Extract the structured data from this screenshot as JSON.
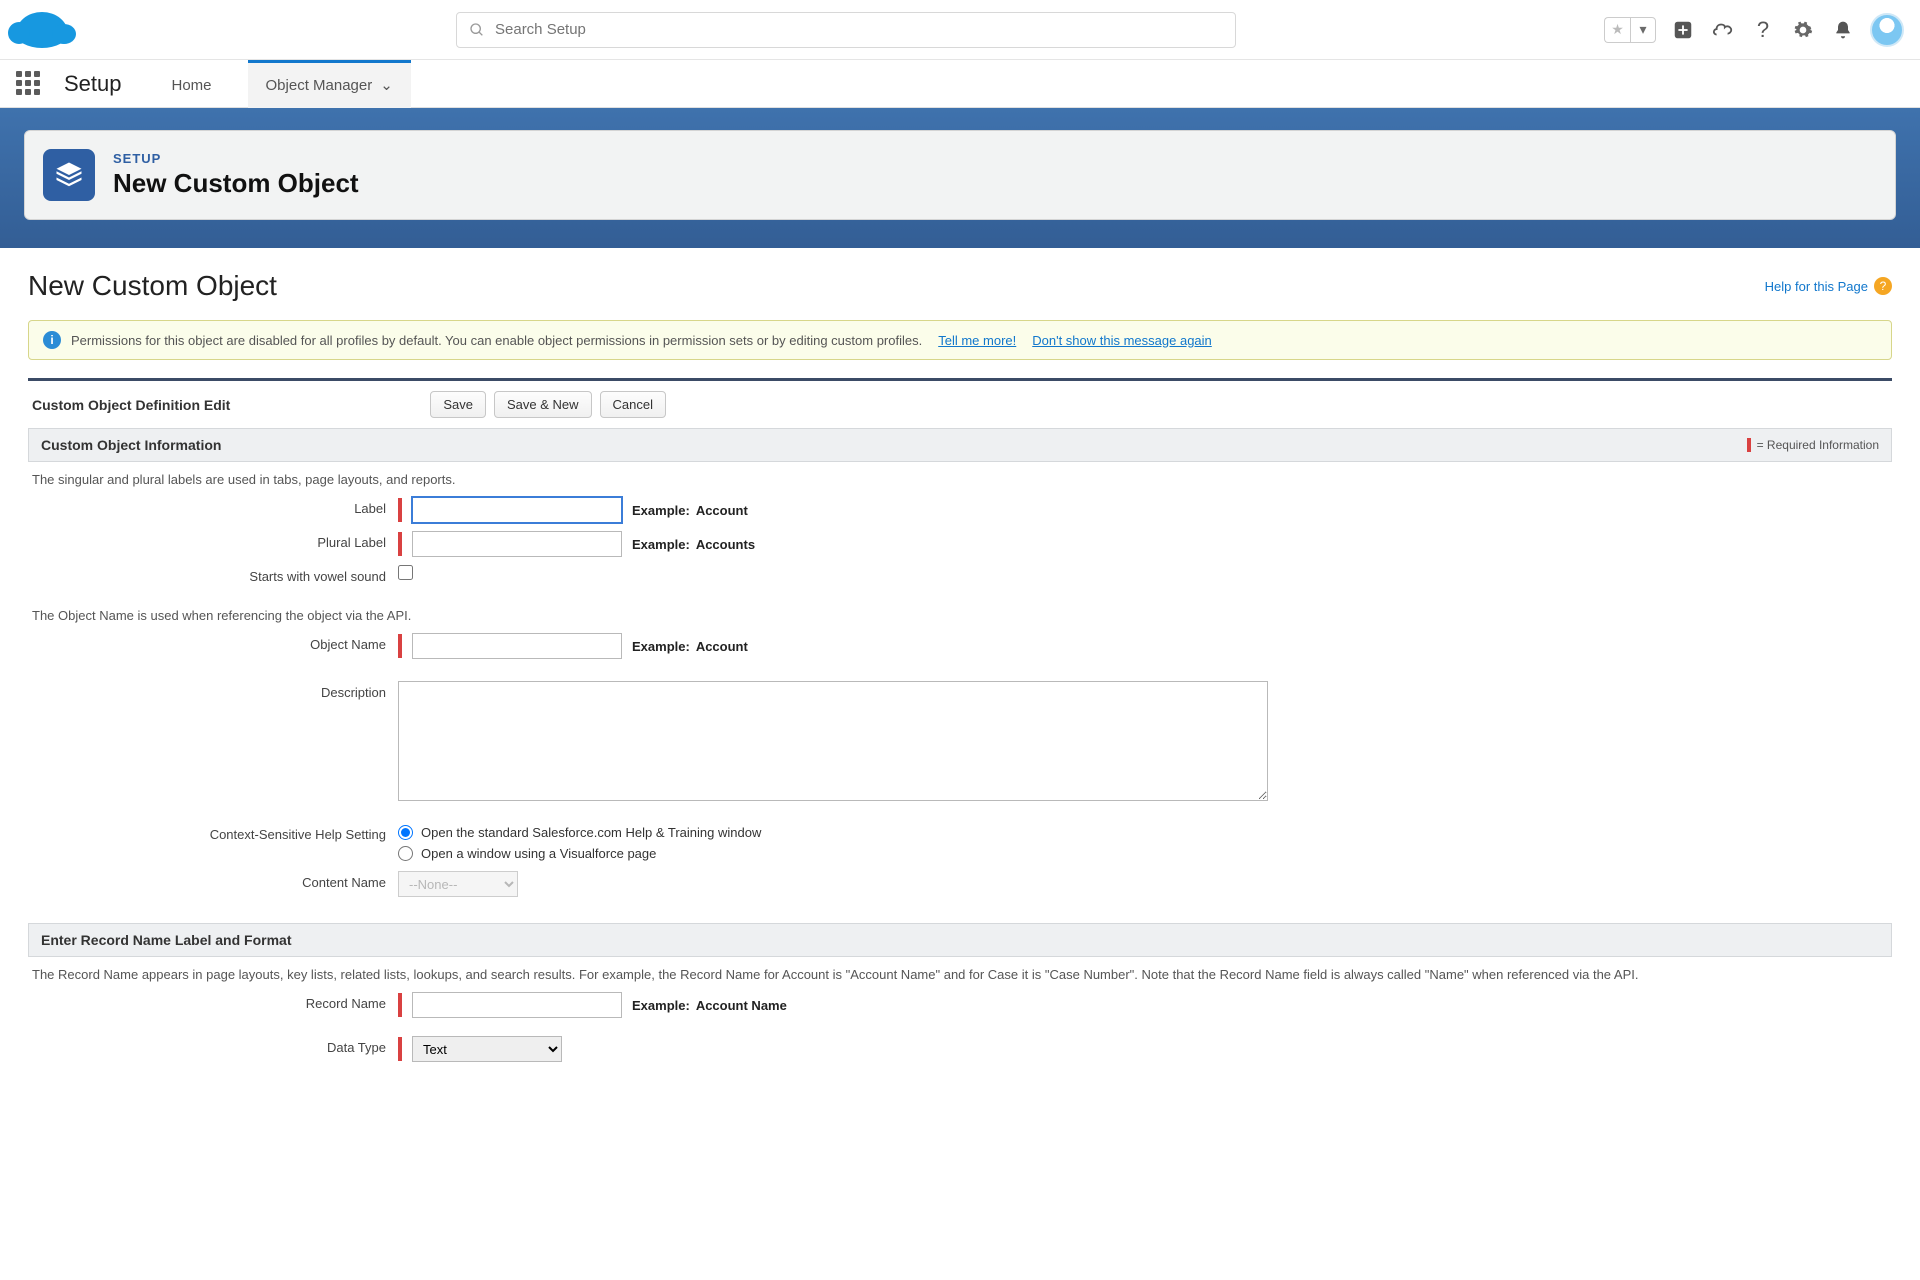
{
  "search": {
    "placeholder": "Search Setup"
  },
  "nav": {
    "context": "Setup",
    "tab_home": "Home",
    "tab_obj_mgr": "Object Manager"
  },
  "header": {
    "crumb": "SETUP",
    "title": "New Custom Object"
  },
  "page": {
    "title": "New Custom Object",
    "help_label": "Help for this Page"
  },
  "notice": {
    "text": "Permissions for this object are disabled for all profiles by default. You can enable object permissions in permission sets or by editing custom profiles.",
    "link1": "Tell me more!",
    "link2": "Don't show this message again"
  },
  "def_edit": {
    "heading": "Custom Object Definition Edit",
    "save": "Save",
    "save_new": "Save & New",
    "cancel": "Cancel"
  },
  "sec_info": {
    "heading": "Custom Object Information",
    "required_note": "= Required Information",
    "help1": "The singular and plural labels are used in tabs, page layouts, and reports.",
    "label": "Label",
    "ex_label_key": "Example:",
    "ex_label_val": "Account",
    "plural": "Plural Label",
    "ex_plural_val": "Accounts",
    "vowel": "Starts with vowel sound",
    "help2": "The Object Name is used when referencing the object via the API.",
    "objname": "Object Name",
    "ex_objname_val": "Account",
    "desc": "Description",
    "help_setting": "Context-Sensitive Help Setting",
    "radio1": "Open the standard Salesforce.com Help & Training window",
    "radio2": "Open a window using a Visualforce page",
    "content_name": "Content Name",
    "content_name_value": "--None--"
  },
  "sec_record": {
    "heading": "Enter Record Name Label and Format",
    "help": "The Record Name appears in page layouts, key lists, related lists, lookups, and search results. For example, the Record Name for Account is \"Account Name\" and for Case it is \"Case Number\". Note that the Record Name field is always called \"Name\" when referenced via the API.",
    "record_name": "Record Name",
    "ex_record_val": "Account Name",
    "data_type": "Data Type",
    "data_type_value": "Text"
  }
}
